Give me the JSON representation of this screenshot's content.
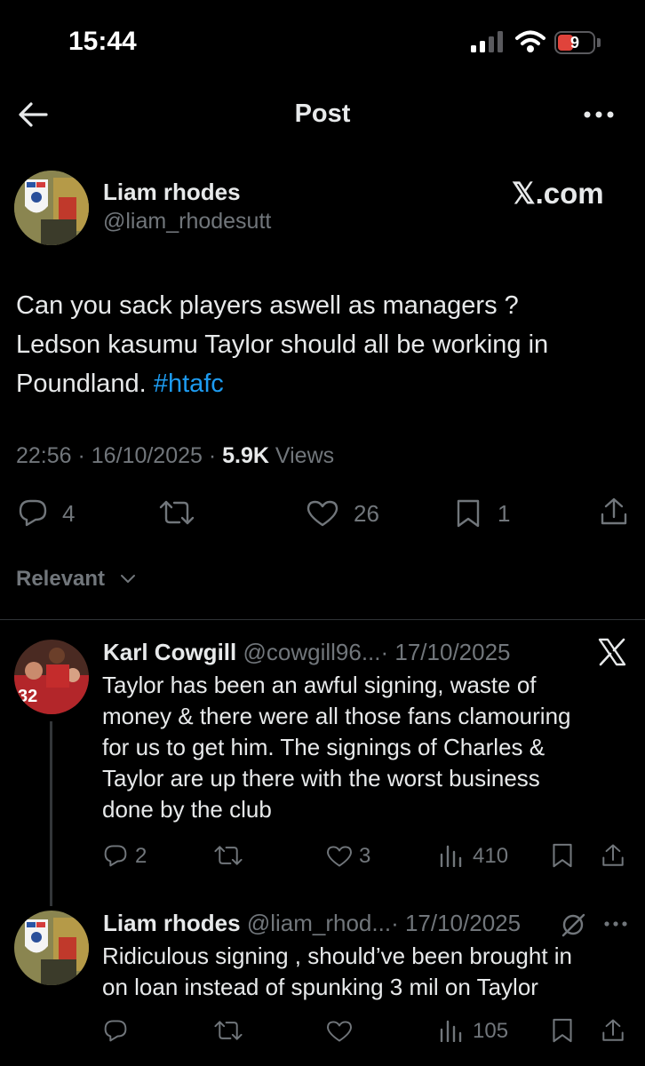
{
  "status_bar": {
    "time": "15:44",
    "battery": "9"
  },
  "header": {
    "title": "Post"
  },
  "post": {
    "author_name": "Liam rhodes",
    "author_handle": "@liam_rhodesutt",
    "source_label": "𝕏.com",
    "text_line1": "Can you sack players aswell as managers ?",
    "text_line2": "Ledson kasumu Taylor should all be working in",
    "text_line3_pre": "Poundland. ",
    "hashtag": "#htafc",
    "time": "22:56",
    "date": "16/10/2025",
    "views_count": "5.9K",
    "views_label": "Views",
    "replies": "4",
    "likes": "26",
    "bookmarks": "1"
  },
  "sort": {
    "label": "Relevant"
  },
  "replies": [
    {
      "author_name": "Karl Cowgill",
      "handle": "@cowgill96...",
      "date": "· 17/10/2025",
      "lines": [
        "Taylor has been an awful signing, waste of",
        "money & there were all those fans clamouring",
        "for us to get him. The signings of Charles &",
        "Taylor are up there with the worst business",
        "done by the club"
      ],
      "replies": "2",
      "likes": "3",
      "views": "410"
    },
    {
      "author_name": "Liam rhodes",
      "handle": "@liam_rhod...",
      "date": "· 17/10/2025",
      "lines": [
        "Ridiculous signing , should’ve been brought in",
        "on loan instead of spunking 3 mil on Taylor"
      ],
      "views": "105"
    }
  ],
  "colors": {
    "background": "#000000",
    "text": "#e7e9ea",
    "muted": "#71767b",
    "link": "#1d9bf0",
    "battery": "#e0433b"
  }
}
